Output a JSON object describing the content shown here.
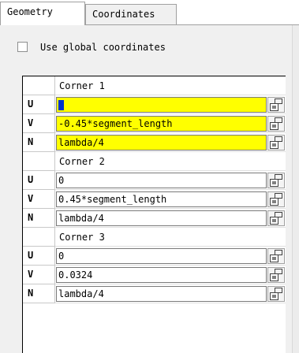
{
  "tabs": [
    {
      "label": "Geometry",
      "active": true
    },
    {
      "label": "Coordinates",
      "active": false
    }
  ],
  "use_global_coordinates": {
    "label": "Use global coordinates",
    "checked": false
  },
  "highlight_color": "#ffff00",
  "corners": [
    {
      "title": "Corner 1",
      "rows": [
        {
          "key": "U",
          "value": "0",
          "highlighted": true
        },
        {
          "key": "V",
          "value": "-0.45*segment_length",
          "highlighted": true
        },
        {
          "key": "N",
          "value": "lambda/4",
          "highlighted": true
        }
      ]
    },
    {
      "title": "Corner 2",
      "rows": [
        {
          "key": "U",
          "value": "0",
          "highlighted": false
        },
        {
          "key": "V",
          "value": "0.45*segment_length",
          "highlighted": false
        },
        {
          "key": "N",
          "value": "lambda/4",
          "highlighted": false
        }
      ]
    },
    {
      "title": "Corner 3",
      "rows": [
        {
          "key": "U",
          "value": "0",
          "highlighted": false
        },
        {
          "key": "V",
          "value": "0.0324",
          "highlighted": false
        },
        {
          "key": "N",
          "value": "lambda/4",
          "highlighted": false
        }
      ]
    }
  ]
}
